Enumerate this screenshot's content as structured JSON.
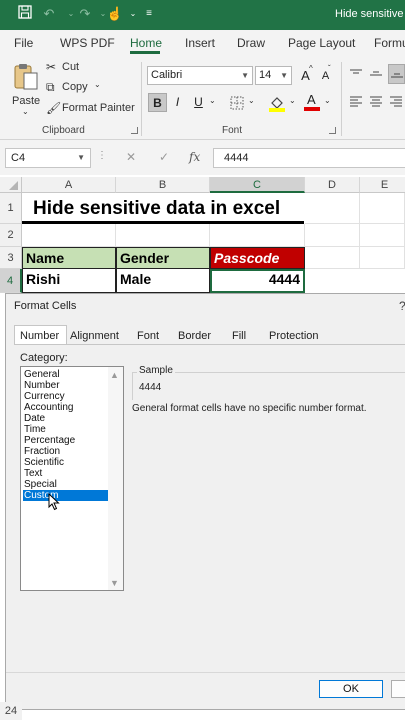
{
  "titlebar": {
    "title": "Hide sensitive d"
  },
  "ribbon_tabs": [
    "File",
    "WPS PDF",
    "Home",
    "Insert",
    "Draw",
    "Page Layout",
    "Formu"
  ],
  "clipboard": {
    "paste": "Paste",
    "cut": "Cut",
    "copy": "Copy",
    "format_painter": "Format Painter",
    "group_label": "Clipboard"
  },
  "font": {
    "name": "Calibri",
    "size": "14",
    "group_label": "Font",
    "grow": "A",
    "shrink": "A",
    "bold": "B",
    "italic": "I",
    "underline": "U",
    "font_color_letter": "A"
  },
  "formula_bar": {
    "cell_ref": "C4",
    "fx": "fx",
    "value": "4444"
  },
  "columns": [
    "A",
    "B",
    "C",
    "D",
    "E"
  ],
  "rows": [
    "1",
    "2",
    "3",
    "4"
  ],
  "sheet": {
    "title": "Hide sensitive data in excel",
    "headers": [
      "Name",
      "Gender",
      "Passcode"
    ],
    "row4": [
      "Rishi",
      "Male",
      "4444"
    ],
    "bottom_row": "24"
  },
  "dialog": {
    "title": "Format Cells",
    "help": "?",
    "tabs": [
      "Number",
      "Alignment",
      "Font",
      "Border",
      "Fill",
      "Protection"
    ],
    "category_label": "Category:",
    "categories": [
      "General",
      "Number",
      "Currency",
      "Accounting",
      "Date",
      "Time",
      "Percentage",
      "Fraction",
      "Scientific",
      "Text",
      "Special",
      "Custom"
    ],
    "selected_category": "Custom",
    "sample_label": "Sample",
    "sample_value": "4444",
    "description": "General format cells have no specific number format.",
    "ok": "OK"
  },
  "colors": {
    "excel_green": "#217346",
    "header_green_fill": "#c6e0b4",
    "passcode_red_fill": "#c00000",
    "selection_blue": "#0078d7"
  }
}
